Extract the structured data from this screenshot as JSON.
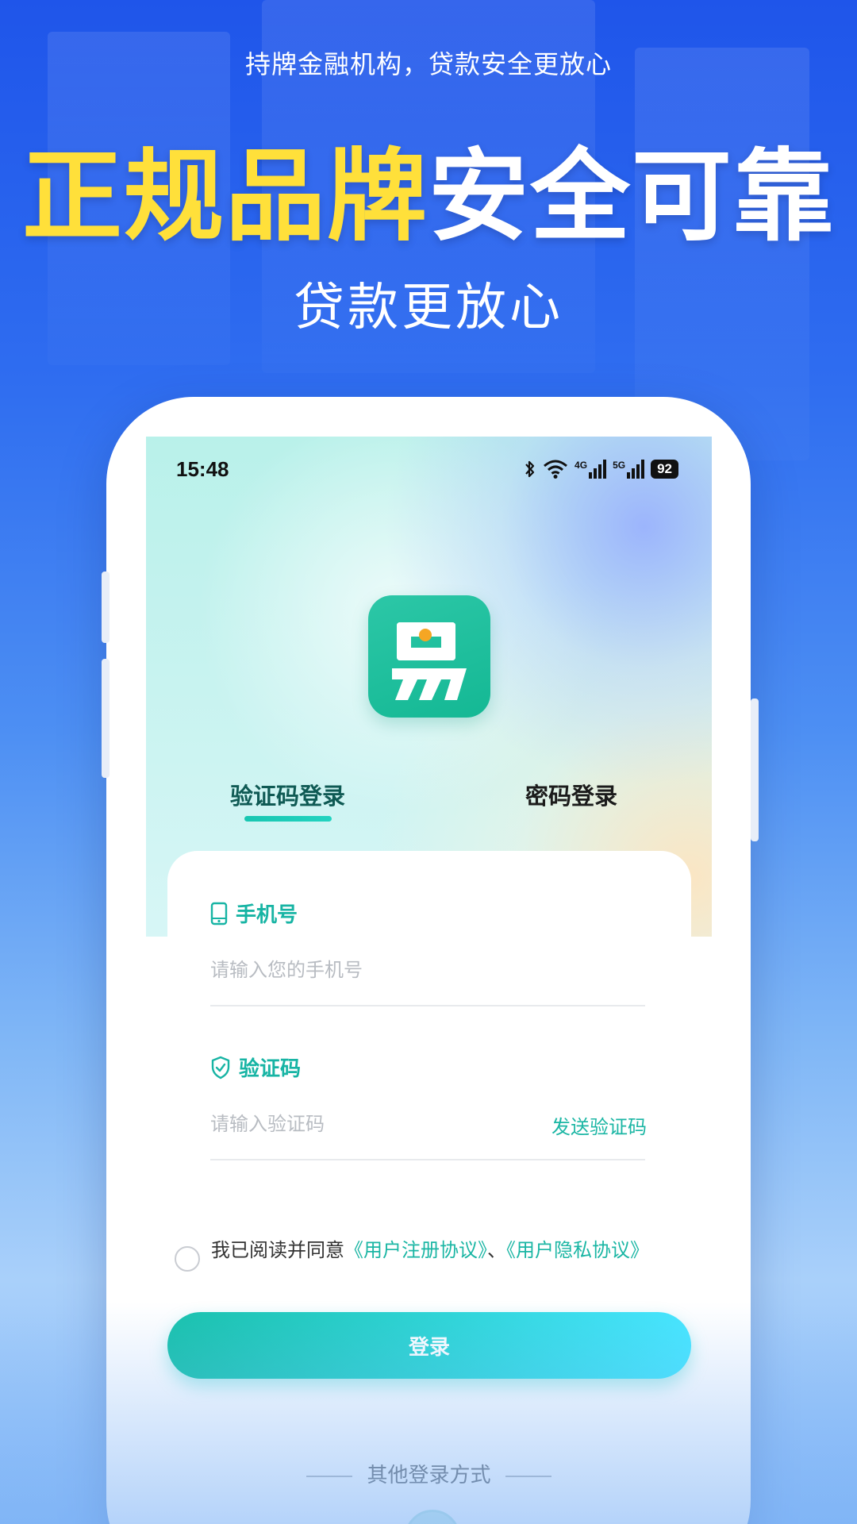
{
  "banner": {
    "tagline": "持牌金融机构，贷款安全更放心",
    "headline_yellow": "正规品牌",
    "headline_white": "安全可靠",
    "subline": "贷款更放心"
  },
  "status_bar": {
    "time": "15:48",
    "network_4g": "4G",
    "network_5g": "5G",
    "battery": "92"
  },
  "logo": {
    "glyph": "易"
  },
  "tabs": [
    {
      "label": "验证码登录",
      "active": true
    },
    {
      "label": "密码登录",
      "active": false
    }
  ],
  "form": {
    "phone_label": "手机号",
    "phone_placeholder": "请输入您的手机号",
    "code_label": "验证码",
    "code_placeholder": "请输入验证码",
    "send_code_label": "发送验证码"
  },
  "agreement": {
    "prefix": "我已阅读并同意",
    "link1": "《用户注册协议》",
    "separator": "、",
    "link2": "《用户隐私协议》"
  },
  "login_button": "登录",
  "other_login": "其他登录方式",
  "colors": {
    "accent": "#1bb6a4",
    "brand_green": "#14b894",
    "headline_yellow": "#ffe03a",
    "background_blue": "#2f6df0"
  }
}
